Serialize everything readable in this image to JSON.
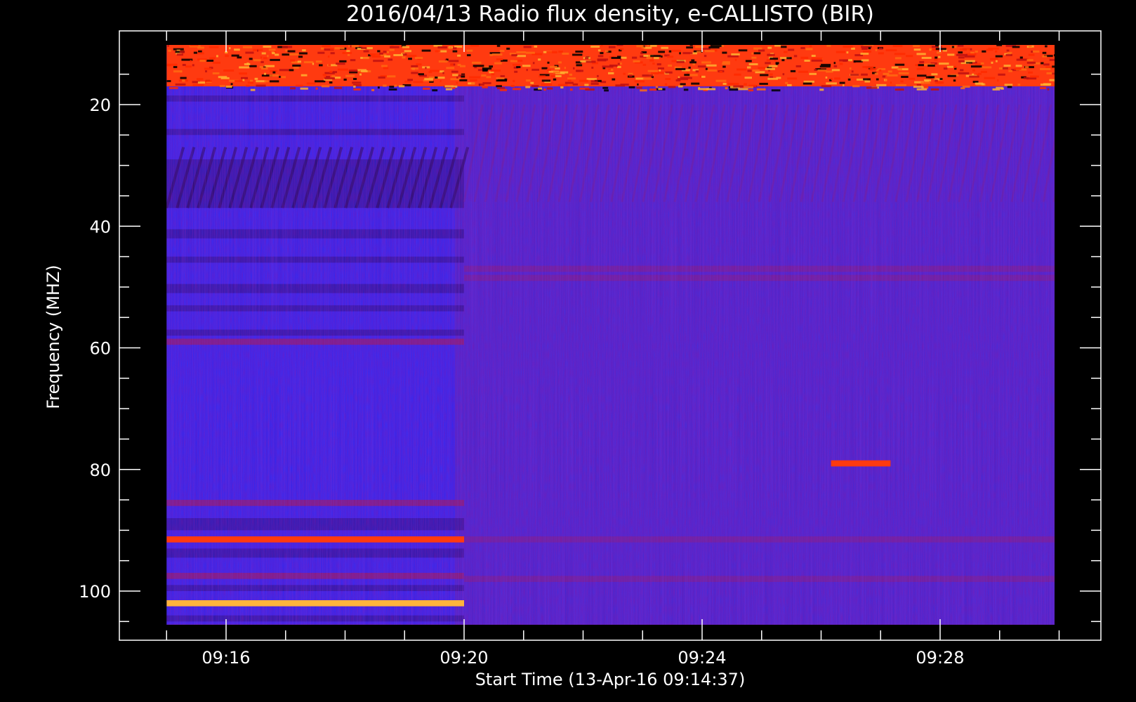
{
  "chart_data": {
    "type": "heatmap",
    "title": "2016/04/13  Radio flux density, e-CALLISTO (BIR)",
    "xlabel": "Start Time (13-Apr-16 09:14:37)",
    "ylabel": "Frequency (MHZ)",
    "x_range": [
      "09:14:37",
      "09:30:00"
    ],
    "y_range_mhz": [
      10,
      106
    ],
    "x_ticks": [
      "09:16",
      "09:20",
      "09:24",
      "09:28"
    ],
    "y_ticks": [
      "20",
      "40",
      "60",
      "80",
      "100"
    ],
    "y_tick_values": [
      20,
      40,
      60,
      80,
      100
    ],
    "y_reversed": true,
    "colormap": [
      "#000000",
      "#1a1aff",
      "#3a2dd6",
      "#b01020",
      "#ff3300",
      "#ffcc40"
    ],
    "bands": [
      {
        "t_start": "09:15:00",
        "t_end": "09:30:00",
        "f_low": 10,
        "f_high": 17,
        "level": "strong"
      },
      {
        "t_start": "09:15:00",
        "t_end": "09:20:00",
        "f_low": 29,
        "f_high": 37,
        "level": "low"
      },
      {
        "t_start": "09:15:00",
        "t_end": "09:20:00",
        "f_low": 91,
        "f_high": 92,
        "level": "strong"
      },
      {
        "t_start": "09:15:00",
        "t_end": "09:20:00",
        "f_low": 101.5,
        "f_high": 102.5,
        "level": "very strong"
      },
      {
        "t_start": "09:26:10",
        "t_end": "09:27:10",
        "f_low": 78.5,
        "f_high": 79.5,
        "level": "strong"
      }
    ]
  }
}
